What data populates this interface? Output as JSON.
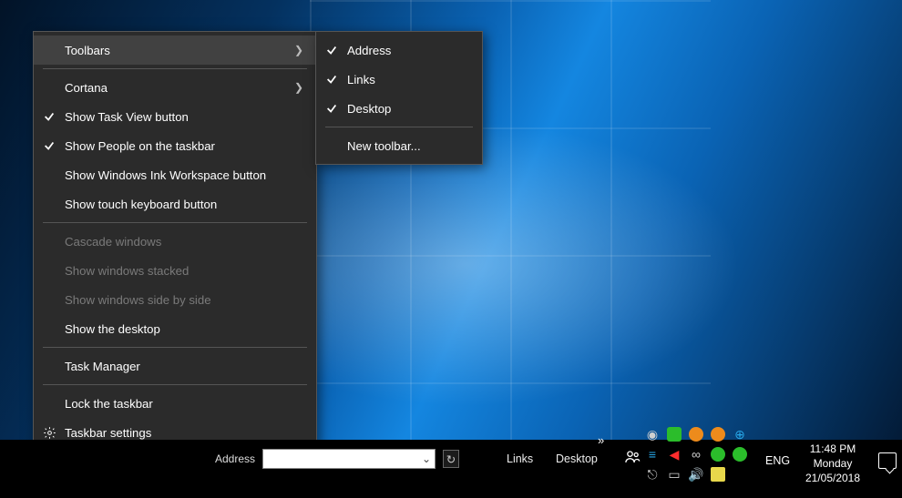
{
  "context_menu": {
    "items": [
      {
        "label": "Toolbars",
        "submenu": true,
        "hover": true
      },
      {
        "sep": true
      },
      {
        "label": "Cortana",
        "submenu": true
      },
      {
        "label": "Show Task View button",
        "checked": true
      },
      {
        "label": "Show People on the taskbar",
        "checked": true
      },
      {
        "label": "Show Windows Ink Workspace button"
      },
      {
        "label": "Show touch keyboard button"
      },
      {
        "sep": true
      },
      {
        "label": "Cascade windows",
        "disabled": true
      },
      {
        "label": "Show windows stacked",
        "disabled": true
      },
      {
        "label": "Show windows side by side",
        "disabled": true
      },
      {
        "label": "Show the desktop"
      },
      {
        "sep": true
      },
      {
        "label": "Task Manager"
      },
      {
        "sep": true
      },
      {
        "label": "Lock the taskbar"
      },
      {
        "label": "Taskbar settings",
        "icon": "gear"
      }
    ]
  },
  "submenu": {
    "items": [
      {
        "label": "Address",
        "checked": true
      },
      {
        "label": "Links",
        "checked": true
      },
      {
        "label": "Desktop",
        "checked": true
      },
      {
        "sep": true
      },
      {
        "label": "New toolbar..."
      }
    ]
  },
  "taskbar": {
    "address_label": "Address",
    "links_label": "Links",
    "desktop_label": "Desktop",
    "lang": "ENG",
    "time": "11:48 PM",
    "day": "Monday",
    "date": "21/05/2018",
    "tray_icons": [
      "spiral-icon",
      "nvidia-icon",
      "shield-icon",
      "blob-icon",
      "discord-icon",
      "net-icon",
      "volume-mute-icon",
      "link-icon",
      "whatsapp-icon",
      "n-icon",
      "usb-icon",
      "laptop-icon",
      "speaker-icon",
      "note-icon"
    ]
  }
}
